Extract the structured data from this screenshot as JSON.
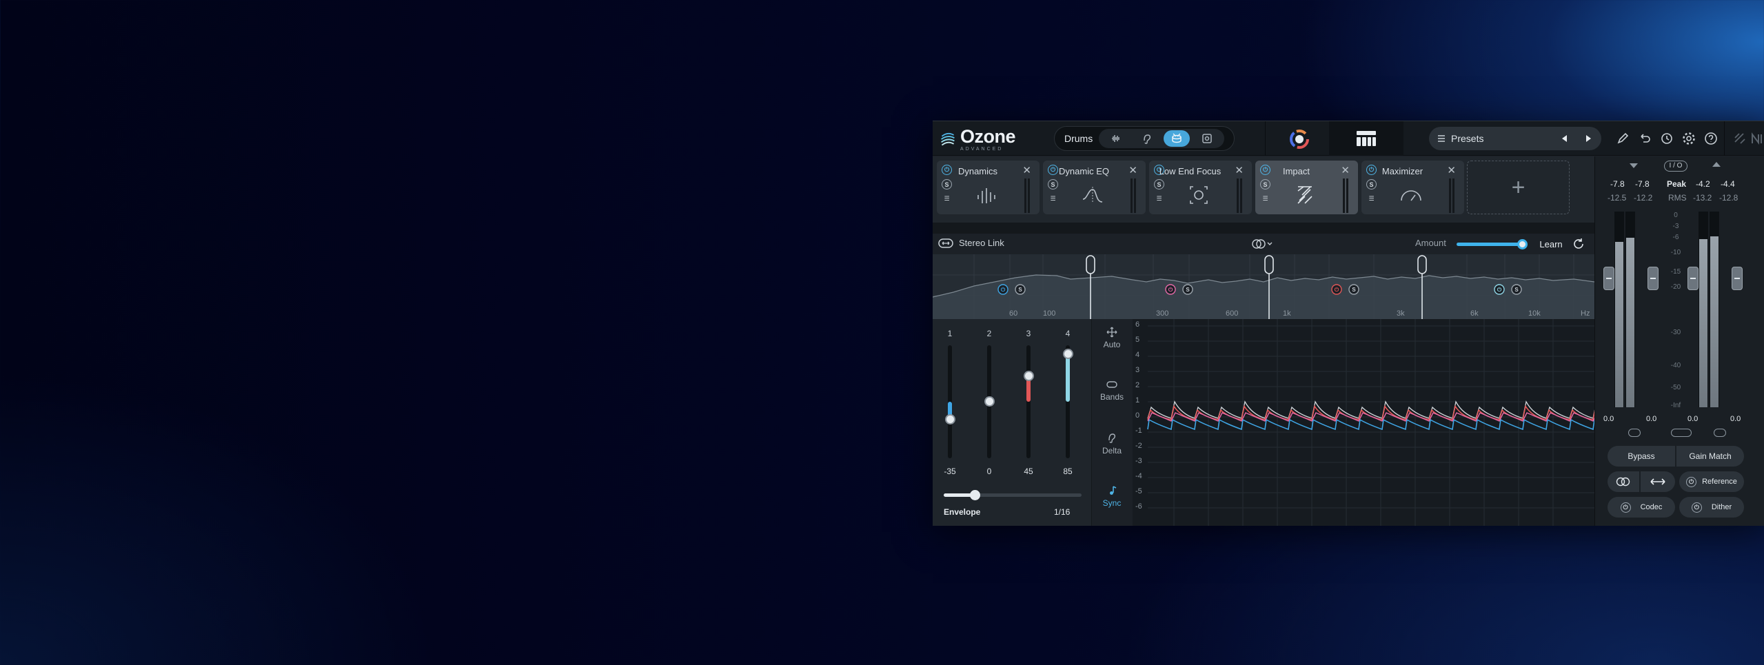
{
  "app": {
    "logo_name": "Ozone",
    "logo_sub": "ADVANCED",
    "assistant_label": "Drums",
    "presets_label": "Presets"
  },
  "modules": [
    {
      "name": "Dynamics"
    },
    {
      "name": "Dynamic EQ"
    },
    {
      "name": "Low End Focus"
    },
    {
      "name": "Impact",
      "active": true
    },
    {
      "name": "Maximizer"
    }
  ],
  "toolbar": {
    "stereo_link": "Stereo Link",
    "amount_label": "Amount",
    "amount_value": 0.92,
    "learn_label": "Learn"
  },
  "spectrum": {
    "freq_labels": [
      "60",
      "100",
      "300",
      "600",
      "1k",
      "3k",
      "6k",
      "10k",
      "Hz"
    ]
  },
  "bands": {
    "items": [
      {
        "num": "1",
        "value": "-35",
        "color": "#3fa6e6"
      },
      {
        "num": "2",
        "value": "0",
        "color": "#9aa3ab"
      },
      {
        "num": "3",
        "value": "45",
        "color": "#e25757"
      },
      {
        "num": "4",
        "value": "85",
        "color": "#8fd6e6"
      }
    ],
    "envelope_label": "Envelope",
    "envelope_value": "1/16"
  },
  "tools": {
    "auto": "Auto",
    "bands": "Bands",
    "delta": "Delta",
    "sync": "Sync"
  },
  "graph": {
    "yticks": [
      "6",
      "5",
      "4",
      "3",
      "2",
      "1",
      "0",
      "-1",
      "-2",
      "-3",
      "-4",
      "-5",
      "-6"
    ]
  },
  "meters": {
    "io_label": "I / O",
    "in_peak_l": "-7.8",
    "in_peak_r": "-7.8",
    "peak_label": "Peak",
    "out_peak_l": "-4.2",
    "out_peak_r": "-4.4",
    "in_rms_l": "-12.5",
    "in_rms_r": "-12.2",
    "rms_label": "RMS",
    "out_rms_l": "-13.2",
    "out_rms_r": "-12.8",
    "scale": [
      "0",
      "-3",
      "-6",
      "-10",
      "-15",
      "-20",
      "-30",
      "-40",
      "-50",
      "-Inf"
    ],
    "in_gain_l": "0.0",
    "in_gain_r": "0.0",
    "out_gain_l": "0.0",
    "out_gain_r": "0.0",
    "bypass": "Bypass",
    "gain_match": "Gain Match",
    "reference": "Reference",
    "codec": "Codec",
    "dither": "Dither"
  },
  "colors": {
    "accent": "#47a7db",
    "band_red": "#e25757",
    "band_pink": "#e86aa8",
    "band_blue": "#3fa6e6"
  }
}
